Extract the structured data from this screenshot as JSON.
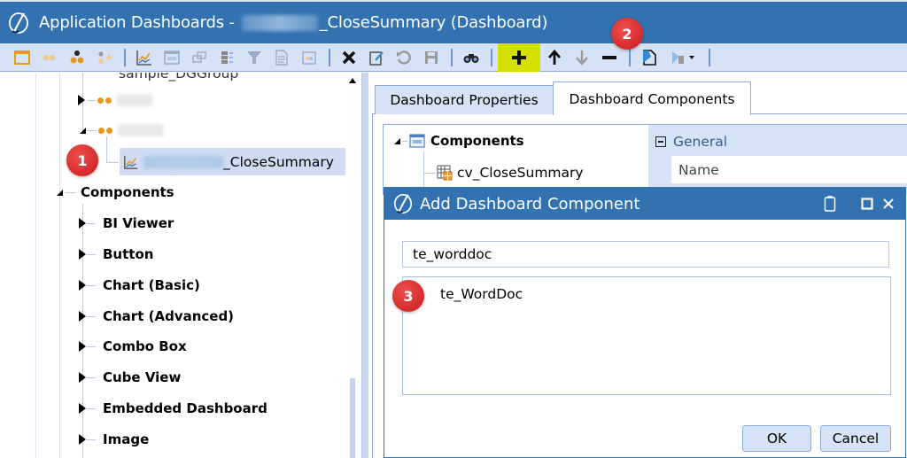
{
  "window": {
    "title_prefix": "Application Dashboards -",
    "title_suffix": "_CloseSummary (Dashboard)",
    "colors": {
      "titlebar": "#3272b0",
      "toolbar": "#d6e2f5",
      "highlight": "#d4e000",
      "badge": "#d42a2a",
      "group_icon": "#e39a1d"
    }
  },
  "toolbar": {
    "buttons": [
      {
        "icon": "new-dashboard-icon"
      },
      {
        "icon": "dashboard-group-icon"
      },
      {
        "icon": "profile-icon"
      },
      {
        "icon": "add-to-profile-icon"
      },
      {
        "icon": "separator"
      },
      {
        "icon": "chart-icon"
      },
      {
        "icon": "layout-icon"
      },
      {
        "icon": "copy-icon"
      },
      {
        "icon": "component-list-icon"
      },
      {
        "icon": "filter-icon"
      },
      {
        "icon": "document-icon"
      },
      {
        "icon": "calendar-icon"
      },
      {
        "icon": "separator"
      },
      {
        "icon": "delete-icon"
      },
      {
        "icon": "rename-icon"
      },
      {
        "icon": "revert-icon"
      },
      {
        "icon": "save-icon"
      },
      {
        "icon": "separator"
      },
      {
        "icon": "search-binoculars-icon"
      },
      {
        "icon": "separator"
      },
      {
        "icon": "add-icon",
        "highlighted": true
      },
      {
        "icon": "move-up-icon"
      },
      {
        "icon": "move-down-icon"
      },
      {
        "icon": "remove-icon"
      },
      {
        "icon": "separator"
      },
      {
        "icon": "open-object-icon"
      },
      {
        "icon": "run-dashboard-icon"
      }
    ]
  },
  "left_tree": {
    "partial_top_label": "sample_DGGroup",
    "group_nodes": [
      {
        "label": "",
        "expanded": false,
        "blurred": true
      },
      {
        "label": "",
        "expanded": true,
        "blurred": true
      }
    ],
    "selected_dashboard": {
      "suffix": "_CloseSummary"
    },
    "components_label": "Components",
    "component_types": [
      "BI Viewer",
      "Button",
      "Chart (Basic)",
      "Chart (Advanced)",
      "Combo Box",
      "Cube View",
      "Embedded Dashboard",
      "Image"
    ]
  },
  "tabs": [
    {
      "label": "Dashboard Properties",
      "active": false
    },
    {
      "label": "Dashboard Components",
      "active": true
    }
  ],
  "components_panel": {
    "root_label": "Components",
    "items": [
      "cv_CloseSummary"
    ]
  },
  "property_grid": {
    "category": "General",
    "first_property": "Name"
  },
  "dialog": {
    "title": "Add Dashboard Component",
    "search_value": "te_worddoc",
    "results": [
      "te_WordDoc"
    ],
    "ok_label": "OK",
    "cancel_label": "Cancel"
  },
  "badges": {
    "one": "1",
    "two": "2",
    "three": "3"
  }
}
